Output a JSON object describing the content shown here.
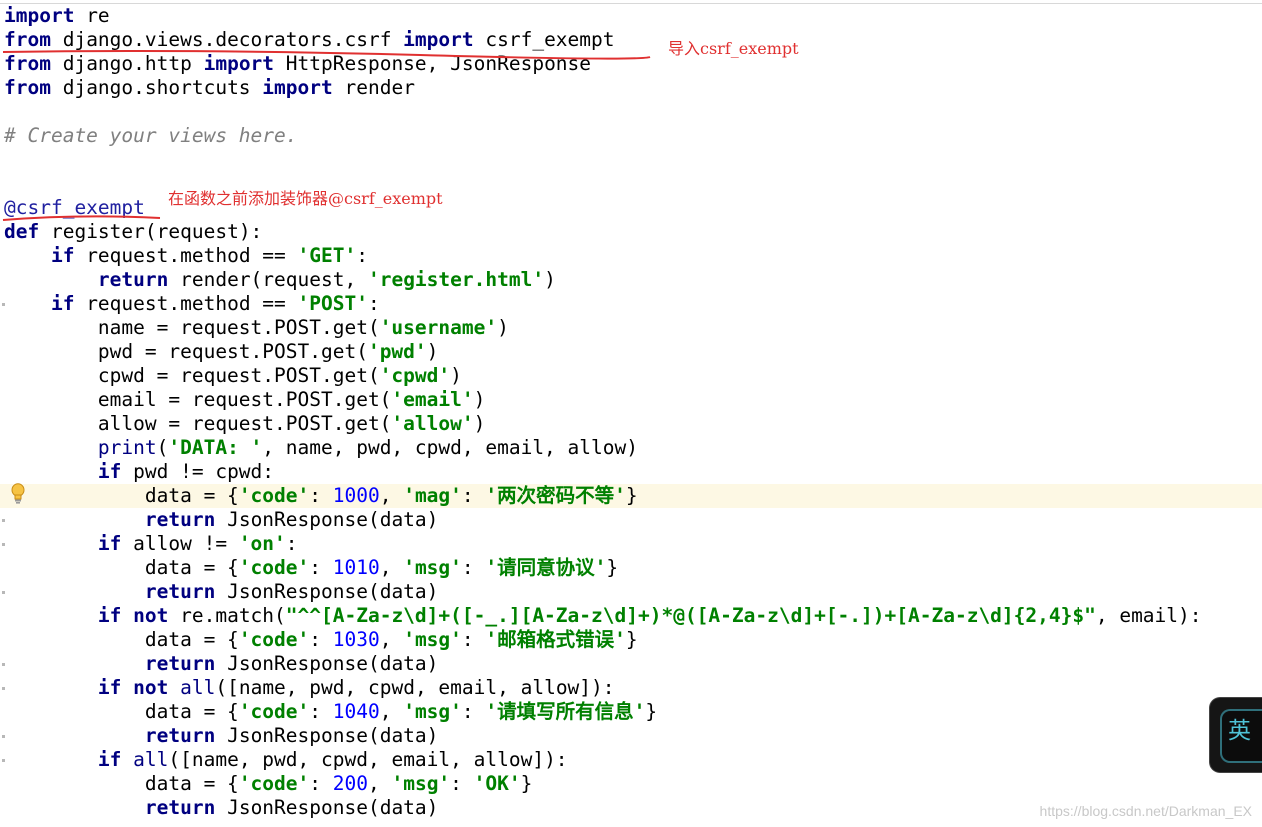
{
  "code_lines": [
    [
      {
        "t": "import",
        "c": "kw"
      },
      {
        "t": " re"
      }
    ],
    [
      {
        "t": "from",
        "c": "kw"
      },
      {
        "t": " django.views.decorators.csrf "
      },
      {
        "t": "import",
        "c": "kw"
      },
      {
        "t": " csrf_exempt"
      }
    ],
    [
      {
        "t": "from",
        "c": "kw"
      },
      {
        "t": " django.http "
      },
      {
        "t": "import",
        "c": "kw"
      },
      {
        "t": " HttpResponse, JsonResponse"
      }
    ],
    [
      {
        "t": "from",
        "c": "kw"
      },
      {
        "t": " django.shortcuts "
      },
      {
        "t": "import",
        "c": "kw"
      },
      {
        "t": " render"
      }
    ],
    [],
    [
      {
        "t": "# Create your views here.",
        "c": "cmt"
      }
    ],
    [],
    [],
    [
      {
        "t": "@csrf_exempt",
        "c": "dec"
      }
    ],
    [
      {
        "t": "def",
        "c": "kw"
      },
      {
        "t": " register(request):"
      }
    ],
    [
      {
        "t": "    "
      },
      {
        "t": "if",
        "c": "kw"
      },
      {
        "t": " request.method == "
      },
      {
        "t": "'GET'",
        "c": "str"
      },
      {
        "t": ":"
      }
    ],
    [
      {
        "t": "        "
      },
      {
        "t": "return",
        "c": "kw"
      },
      {
        "t": " render(request, "
      },
      {
        "t": "'register.html'",
        "c": "str"
      },
      {
        "t": ")"
      }
    ],
    [
      {
        "t": "    "
      },
      {
        "t": "if",
        "c": "kw"
      },
      {
        "t": " request.method == "
      },
      {
        "t": "'POST'",
        "c": "str"
      },
      {
        "t": ":"
      }
    ],
    [
      {
        "t": "        name = request.POST.get("
      },
      {
        "t": "'username'",
        "c": "str"
      },
      {
        "t": ")"
      }
    ],
    [
      {
        "t": "        pwd = request.POST.get("
      },
      {
        "t": "'pwd'",
        "c": "str"
      },
      {
        "t": ")"
      }
    ],
    [
      {
        "t": "        cpwd = request.POST.get("
      },
      {
        "t": "'cpwd'",
        "c": "str"
      },
      {
        "t": ")"
      }
    ],
    [
      {
        "t": "        email = request.POST.get("
      },
      {
        "t": "'email'",
        "c": "str"
      },
      {
        "t": ")"
      }
    ],
    [
      {
        "t": "        allow = request.POST.get("
      },
      {
        "t": "'allow'",
        "c": "str"
      },
      {
        "t": ")"
      }
    ],
    [
      {
        "t": "        "
      },
      {
        "t": "print",
        "c": "bi"
      },
      {
        "t": "("
      },
      {
        "t": "'DATA: '",
        "c": "str"
      },
      {
        "t": ", name, pwd, cpwd, email, allow)"
      }
    ],
    [
      {
        "t": "        "
      },
      {
        "t": "if",
        "c": "kw"
      },
      {
        "t": " pwd != cpwd:"
      }
    ],
    [
      {
        "t": "            data = {"
      },
      {
        "t": "'code'",
        "c": "str"
      },
      {
        "t": ": "
      },
      {
        "t": "1000",
        "c": "num"
      },
      {
        "t": ", "
      },
      {
        "t": "'mag'",
        "c": "str"
      },
      {
        "t": ": "
      },
      {
        "t": "'两次密码不等'",
        "c": "str"
      },
      {
        "t": "}"
      }
    ],
    [
      {
        "t": "            "
      },
      {
        "t": "return",
        "c": "kw"
      },
      {
        "t": " JsonResponse(data)"
      }
    ],
    [
      {
        "t": "        "
      },
      {
        "t": "if",
        "c": "kw"
      },
      {
        "t": " allow != "
      },
      {
        "t": "'on'",
        "c": "str"
      },
      {
        "t": ":"
      }
    ],
    [
      {
        "t": "            data = {"
      },
      {
        "t": "'code'",
        "c": "str"
      },
      {
        "t": ": "
      },
      {
        "t": "1010",
        "c": "num"
      },
      {
        "t": ", "
      },
      {
        "t": "'msg'",
        "c": "str"
      },
      {
        "t": ": "
      },
      {
        "t": "'请同意协议'",
        "c": "str"
      },
      {
        "t": "}"
      }
    ],
    [
      {
        "t": "            "
      },
      {
        "t": "return",
        "c": "kw"
      },
      {
        "t": " JsonResponse(data)"
      }
    ],
    [
      {
        "t": "        "
      },
      {
        "t": "if not",
        "c": "kw"
      },
      {
        "t": " re.match("
      },
      {
        "t": "\"^^[A-Za-z\\d]+([-_.][A-Za-z\\d]+)*@([A-Za-z\\d]+[-.])+[A-Za-z\\d]{2,4}$\"",
        "c": "str"
      },
      {
        "t": ", email):"
      }
    ],
    [
      {
        "t": "            data = {"
      },
      {
        "t": "'code'",
        "c": "str"
      },
      {
        "t": ": "
      },
      {
        "t": "1030",
        "c": "num"
      },
      {
        "t": ", "
      },
      {
        "t": "'msg'",
        "c": "str"
      },
      {
        "t": ": "
      },
      {
        "t": "'邮箱格式错误'",
        "c": "str"
      },
      {
        "t": "}"
      }
    ],
    [
      {
        "t": "            "
      },
      {
        "t": "return",
        "c": "kw"
      },
      {
        "t": " JsonResponse(data)"
      }
    ],
    [
      {
        "t": "        "
      },
      {
        "t": "if not",
        "c": "kw"
      },
      {
        "t": " "
      },
      {
        "t": "all",
        "c": "bi"
      },
      {
        "t": "([name, pwd, cpwd, email, allow]):"
      }
    ],
    [
      {
        "t": "            data = {"
      },
      {
        "t": "'code'",
        "c": "str"
      },
      {
        "t": ": "
      },
      {
        "t": "1040",
        "c": "num"
      },
      {
        "t": ", "
      },
      {
        "t": "'msg'",
        "c": "str"
      },
      {
        "t": ": "
      },
      {
        "t": "'请填写所有信息'",
        "c": "str"
      },
      {
        "t": "}"
      }
    ],
    [
      {
        "t": "            "
      },
      {
        "t": "return",
        "c": "kw"
      },
      {
        "t": " JsonResponse(data)"
      }
    ],
    [
      {
        "t": "        "
      },
      {
        "t": "if",
        "c": "kw"
      },
      {
        "t": " "
      },
      {
        "t": "all",
        "c": "bi"
      },
      {
        "t": "([name, pwd, cpwd, email, allow]):"
      }
    ],
    [
      {
        "t": "            data = {"
      },
      {
        "t": "'code'",
        "c": "str"
      },
      {
        "t": ": "
      },
      {
        "t": "200",
        "c": "num"
      },
      {
        "t": ", "
      },
      {
        "t": "'msg'",
        "c": "str"
      },
      {
        "t": ": "
      },
      {
        "t": "'OK'",
        "c": "str"
      },
      {
        "t": "}"
      }
    ],
    [
      {
        "t": "            "
      },
      {
        "t": "return",
        "c": "kw"
      },
      {
        "t": " JsonResponse(data)"
      }
    ]
  ],
  "highlighted_line": 20,
  "fold_marker_lines": [
    12,
    21,
    22,
    24,
    27,
    28,
    30,
    31
  ],
  "annotations": {
    "import_note": "导入csrf_exempt",
    "decorator_note": "在函数之前添加装饰器@csrf_exempt",
    "color": "#e03030"
  },
  "ime": {
    "label": "英"
  },
  "watermark": "https://blog.csdn.net/Darkman_EX",
  "colors": {
    "keyword": "#000080",
    "string": "#008000",
    "number": "#0000ff",
    "comment": "#808080",
    "decorator": "#2020a0",
    "current_line": "#fdf8e4"
  },
  "icons": {
    "gutter": "lightbulb-icon"
  }
}
